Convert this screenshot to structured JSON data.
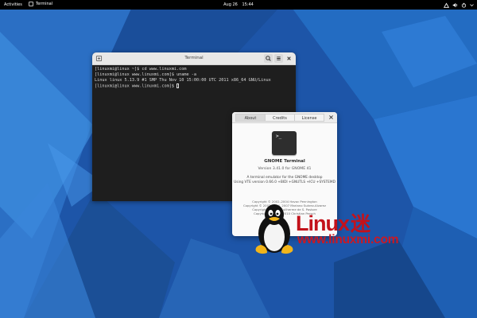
{
  "topbar": {
    "activities": "Activities",
    "app_name": "Terminal",
    "date": "Aug 26",
    "time": "15:44"
  },
  "terminal": {
    "title": "Terminal",
    "lines": [
      "[linuxmi@linux ~]$ cd www.linuxmi.com",
      "[linuxmi@linux www.linuxmi.com]$ uname -a",
      "Linux linux 5.13.9 #1 SMP Thu Nov 10 15:00:00 UTC 2011 x86_64 GNU/Linux",
      "[linuxmi@linux www.linuxmi.com]$ "
    ]
  },
  "about": {
    "tabs": [
      "About",
      "Credits",
      "License"
    ],
    "active_tab": "About",
    "app_name": "GNOME Terminal",
    "version": "Version 3.41.0 for GNOME 41",
    "description_1": "A terminal emulator for the GNOME desktop",
    "description_2": "Using VTE version 0.66.0 +BIDI +GNUTLS +ICU +SYSTEMD",
    "copyright": [
      "Copyright © 2002–2004 Havoc Pennington",
      "Copyright © 2003–2004, 2007 Mariano Suárez-Alvarez",
      "Copyright © 2006 Guilherme de S. Pastore",
      "Copyright © 2007–2010 Christian Persch"
    ]
  },
  "watermark": {
    "brand": "Linux",
    "brand_cn": "迷",
    "url": "www.linuxmi.com"
  },
  "colors": {
    "wallpaper": "#1b4f9e",
    "topbar": "#000000",
    "terminal_bg": "#1e1e1e",
    "watermark_red": "#cc1822"
  }
}
